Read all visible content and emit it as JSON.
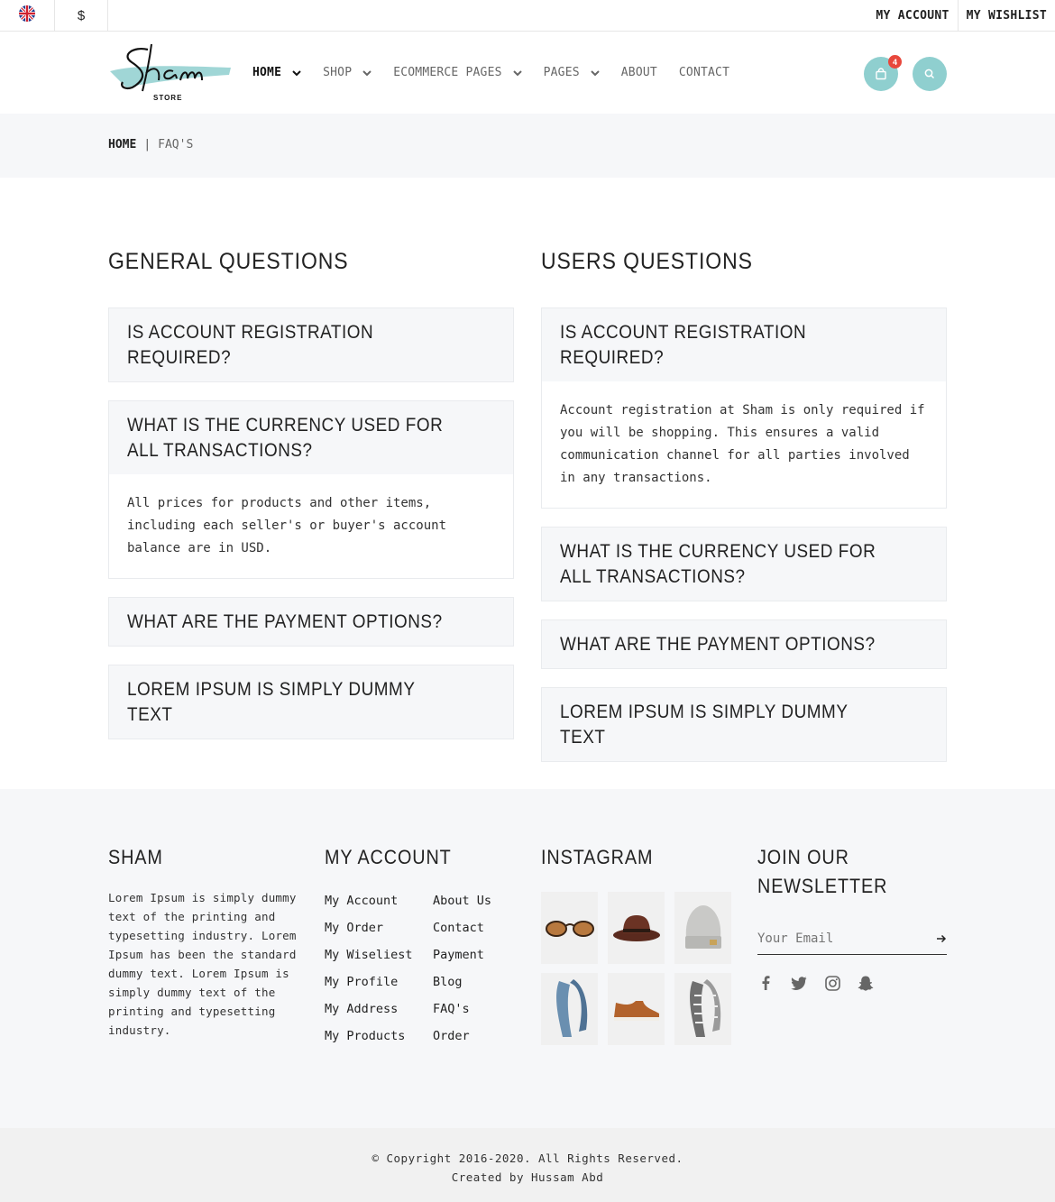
{
  "topbar": {
    "flag_icon": "uk-flag-icon",
    "currency": "$",
    "links": [
      "MY ACCOUNT",
      "MY WISHLIST"
    ]
  },
  "header": {
    "logo_text": "Sham",
    "logo_sub": "STORE",
    "nav": [
      {
        "label": "HOME",
        "dropdown": true,
        "active": true
      },
      {
        "label": "SHOP",
        "dropdown": true
      },
      {
        "label": "ECOMMERCE PAGES",
        "dropdown": true
      },
      {
        "label": "PAGES",
        "dropdown": true
      },
      {
        "label": "ABOUT",
        "dropdown": false
      },
      {
        "label": "CONTACT",
        "dropdown": false
      }
    ],
    "cart_count": "4",
    "accent": "#8fcfcf",
    "badge_color": "#e8473c"
  },
  "breadcrumb": {
    "home": "HOME",
    "separator": "|",
    "current": "FAQ'S"
  },
  "faq": {
    "general": {
      "title": "GENERAL QUESTIONS",
      "items": [
        {
          "q": "IS ACCOUNT REGISTRATION REQUIRED?",
          "a": ""
        },
        {
          "q": "WHAT IS THE CURRENCY USED FOR ALL TRANSACTIONS?",
          "a": "All prices for products and other items, including each seller's or buyer's account balance are in USD."
        },
        {
          "q": "WHAT ARE THE PAYMENT OPTIONS?",
          "a": ""
        },
        {
          "q": "LOREM IPSUM IS SIMPLY DUMMY TEXT",
          "a": ""
        }
      ]
    },
    "users": {
      "title": "USERS QUESTIONS",
      "items": [
        {
          "q": "IS ACCOUNT REGISTRATION REQUIRED?",
          "a": "Account registration at Sham is only required if you will be shopping. This ensures a valid communication channel for all parties involved in any transactions."
        },
        {
          "q": "WHAT IS THE CURRENCY USED FOR ALL TRANSACTIONS?",
          "a": ""
        },
        {
          "q": "WHAT ARE THE PAYMENT OPTIONS?",
          "a": ""
        },
        {
          "q": "LOREM IPSUM IS SIMPLY DUMMY TEXT",
          "a": ""
        }
      ]
    }
  },
  "footer": {
    "about_title": "SHAM",
    "about_text": "Lorem Ipsum is simply dummy text of the printing and typesetting industry. Lorem Ipsum has been the standard dummy text. Lorem Ipsum is simply dummy text of the printing and typesetting industry.",
    "account_title": "MY ACCOUNT",
    "account_links_1": [
      "My Account",
      "My Order",
      "My Wiseliest",
      "My Profile",
      "My Address",
      "My Products"
    ],
    "account_links_2": [
      "About Us",
      "Contact",
      "Payment",
      "Blog",
      "FAQ's",
      "Order"
    ],
    "instagram_title": "INSTAGRAM",
    "instagram_items": [
      "sunglasses",
      "hat",
      "beanie",
      "scarf",
      "shoe",
      "patterned-scarf"
    ],
    "newsletter_title": "JOIN OUR NEWSLETTER",
    "newsletter_placeholder": "Your Email",
    "social": [
      "facebook-icon",
      "twitter-icon",
      "instagram-icon",
      "snapchat-icon"
    ]
  },
  "copyright": {
    "line1": "© Copyright 2016-2020. All Rights Reserved.",
    "line2": "Created by Hussam Abd"
  }
}
